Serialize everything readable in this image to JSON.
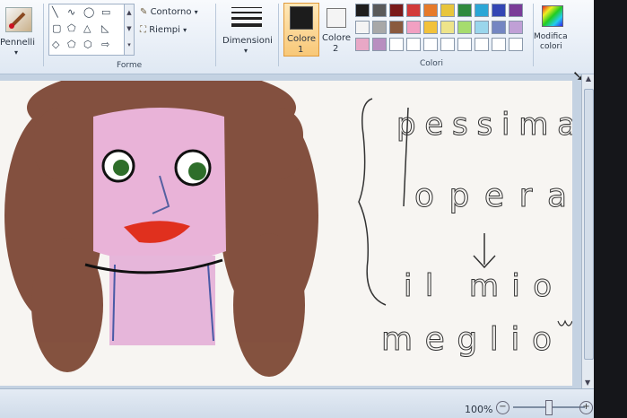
{
  "ribbon": {
    "brushes_label": "Pennelli",
    "shapes_group_label": "Forme",
    "outline_label": "Contorno",
    "fill_label": "Riempi",
    "size_label": "Dimensioni",
    "color1_label": "Colore",
    "color1_number": "1",
    "color2_label": "Colore",
    "color2_number": "2",
    "colors_group_label": "Colori",
    "edit_colors_label_line1": "Modifica",
    "edit_colors_label_line2": "colori",
    "color1_value": "#1c1c1c",
    "color2_value": "#f4f4f4",
    "palette_row1": [
      "#1d1d1d",
      "#5a5a5a",
      "#7a1a1a",
      "#d23a3a",
      "#e67a2a",
      "#e8c53c",
      "#2f8a3e",
      "#2aa6d6",
      "#3246b4",
      "#7a3c98"
    ],
    "palette_row2": [
      "#f4f4f4",
      "#a8a8a8",
      "#8a5a3e",
      "#f2a0c2",
      "#f2c23a",
      "#eee48a",
      "#a6dc6e",
      "#9ad6ec",
      "#7486c2",
      "#c0a0d6"
    ],
    "palette_row3": [
      "#e8a8c6",
      "#b88ec0",
      "#ffffff",
      "#ffffff",
      "#ffffff",
      "#ffffff",
      "#ffffff",
      "#ffffff",
      "#ffffff",
      "#ffffff"
    ]
  },
  "status": {
    "zoom": "100%"
  },
  "drawing": {
    "text_line1": "pessima",
    "text_line2": "opera",
    "text_line3": "il mio",
    "text_line4": "meglio"
  }
}
